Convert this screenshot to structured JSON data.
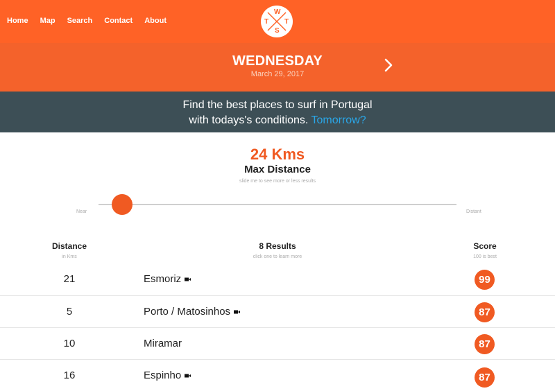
{
  "nav": {
    "items": [
      "Home",
      "Map",
      "Search",
      "Contact",
      "About"
    ]
  },
  "logo": {
    "letters": [
      "W",
      "T",
      "S",
      "T"
    ]
  },
  "day": {
    "name": "WEDNESDAY",
    "date": "March 29, 2017",
    "next_icon": "chevron-right-icon"
  },
  "tagline": {
    "line1": "Find the best places to surf in Portugal",
    "line2": "with todays's conditions.",
    "link": "Tomorrow?"
  },
  "distance": {
    "value": "24 Kms",
    "label": "Max Distance",
    "hint": "slide me to see more or less results",
    "near_label": "Near",
    "far_label": "Distant"
  },
  "table": {
    "col_distance": "Distance",
    "col_distance_sub": "in Kms",
    "col_results": "8 Results",
    "col_results_sub": "click one to learn more",
    "col_score": "Score",
    "col_score_sub": "100 is best",
    "rows": [
      {
        "distance": "21",
        "name": "Esmoriz",
        "camera": true,
        "score": "99"
      },
      {
        "distance": "5",
        "name": "Porto / Matosinhos",
        "camera": true,
        "score": "87"
      },
      {
        "distance": "10",
        "name": "Miramar",
        "camera": false,
        "score": "87"
      },
      {
        "distance": "16",
        "name": "Espinho",
        "camera": true,
        "score": "87"
      }
    ]
  },
  "colors": {
    "brand_orange": "#ff6226",
    "dark_band": "#3d4f56",
    "link_blue": "#2aa7e8"
  }
}
